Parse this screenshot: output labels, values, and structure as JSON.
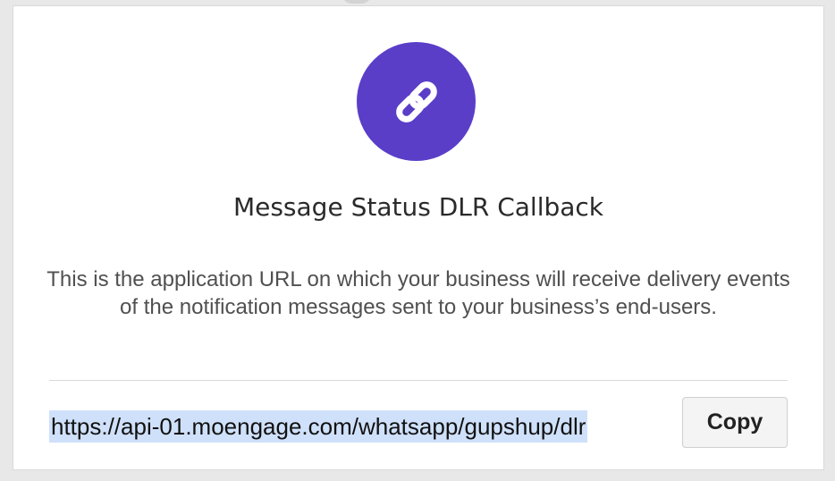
{
  "dialog": {
    "icon": "link-icon",
    "title": "Message Status DLR Callback",
    "description": "This is the application URL on which your business will receive delivery events of the notification messages sent to your business’s end-users.",
    "url": "https://api-01.moengage.com/whatsapp/gupshup/dlr",
    "copy_label": "Copy"
  },
  "colors": {
    "accent": "#5a3ec8",
    "selection": "#cfe0fa"
  }
}
